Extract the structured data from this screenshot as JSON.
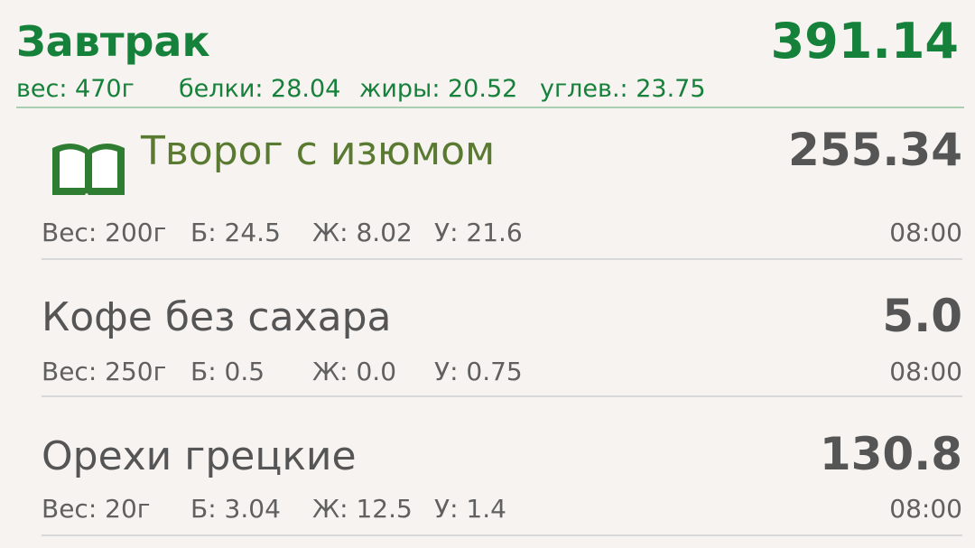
{
  "meal": {
    "title": "Завтрак",
    "total_kcal": "391.14",
    "weight": "вес: 470г",
    "protein": "белки: 28.04",
    "fat": "жиры: 20.52",
    "carbs": "углев.: 23.75"
  },
  "items": [
    {
      "name": "Творог с изюмом",
      "kcal": "255.34",
      "weight": "Вес: 200г",
      "protein": "Б: 24.5",
      "fat": "Ж: 8.02",
      "carbs": "У: 21.6",
      "time": "08:00",
      "icon": "book-icon"
    },
    {
      "name": "Кофе без сахара",
      "kcal": "5.0",
      "weight": "Вес: 250г",
      "protein": "Б: 0.5",
      "fat": "Ж: 0.0",
      "carbs": "У: 0.75",
      "time": "08:00"
    },
    {
      "name": "Орехи грецкие",
      "kcal": "130.8",
      "weight": "Вес: 20г",
      "protein": "Б: 3.04",
      "fat": "Ж: 12.5",
      "carbs": "У: 1.4",
      "time": "08:00"
    }
  ],
  "colors": {
    "accent": "#16813a",
    "recipe_name": "#5a7a32",
    "text": "#555555",
    "background": "#f6f3f0"
  }
}
